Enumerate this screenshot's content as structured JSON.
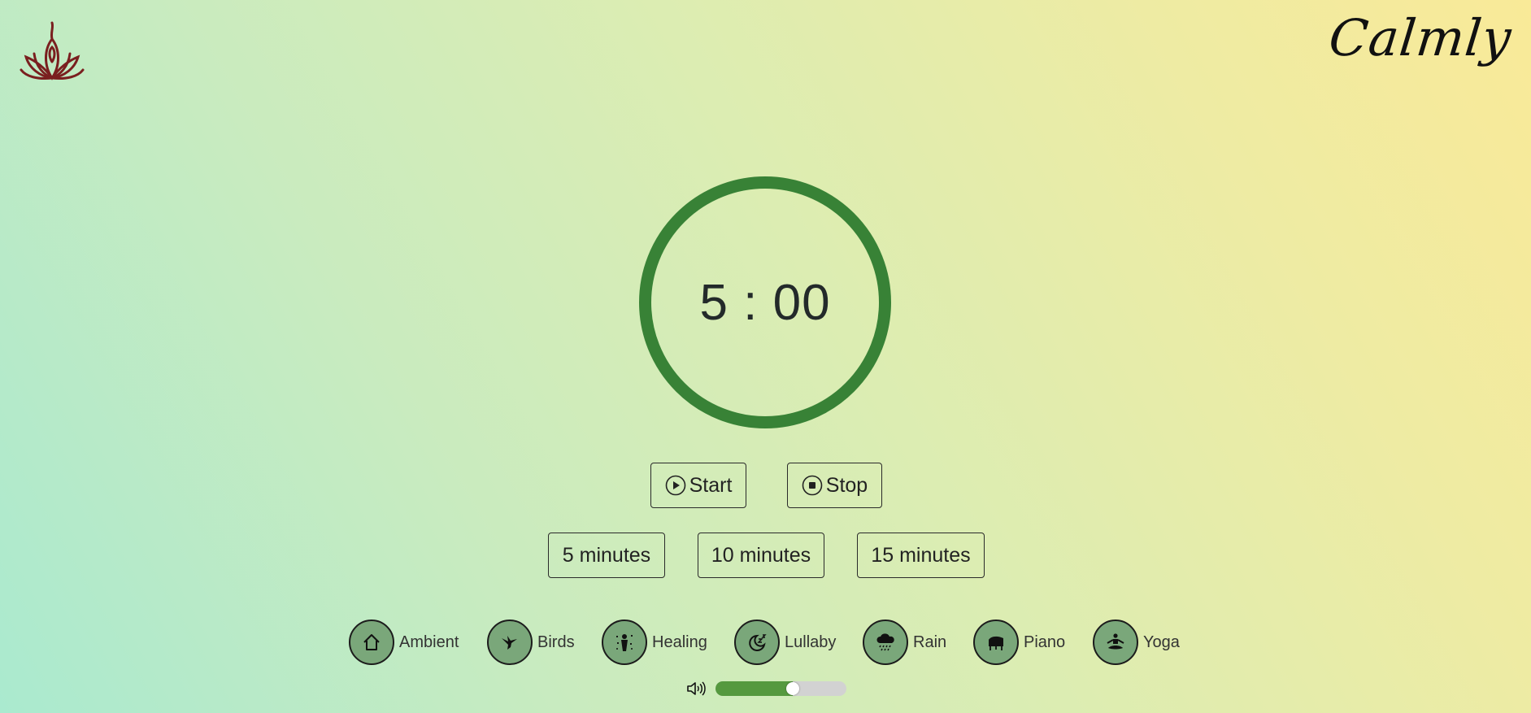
{
  "brand": {
    "logo_icon": "lotus-flame-icon",
    "logo_color": "#7a1f1f",
    "name": "Calmly"
  },
  "timer": {
    "display": "5 : 00",
    "ring_color": "#388236"
  },
  "controls": {
    "start_label": "Start",
    "start_icon": "play-circle-icon",
    "stop_label": "Stop",
    "stop_icon": "stop-circle-icon"
  },
  "durations": [
    {
      "label": "5 minutes"
    },
    {
      "label": "10 minutes"
    },
    {
      "label": "15 minutes"
    }
  ],
  "sounds": [
    {
      "label": "Ambient",
      "icon": "house-icon"
    },
    {
      "label": "Birds",
      "icon": "hummingbird-icon"
    },
    {
      "label": "Healing",
      "icon": "healing-person-icon"
    },
    {
      "label": "Lullaby",
      "icon": "moon-sleep-icon"
    },
    {
      "label": "Rain",
      "icon": "rain-cloud-icon"
    },
    {
      "label": "Piano",
      "icon": "piano-icon"
    },
    {
      "label": "Yoga",
      "icon": "meditation-icon"
    }
  ],
  "volume": {
    "icon": "speaker-icon",
    "level": 0.59,
    "fill_color": "#55993f"
  },
  "colors": {
    "sound_button_bg": "#7aa77a"
  }
}
